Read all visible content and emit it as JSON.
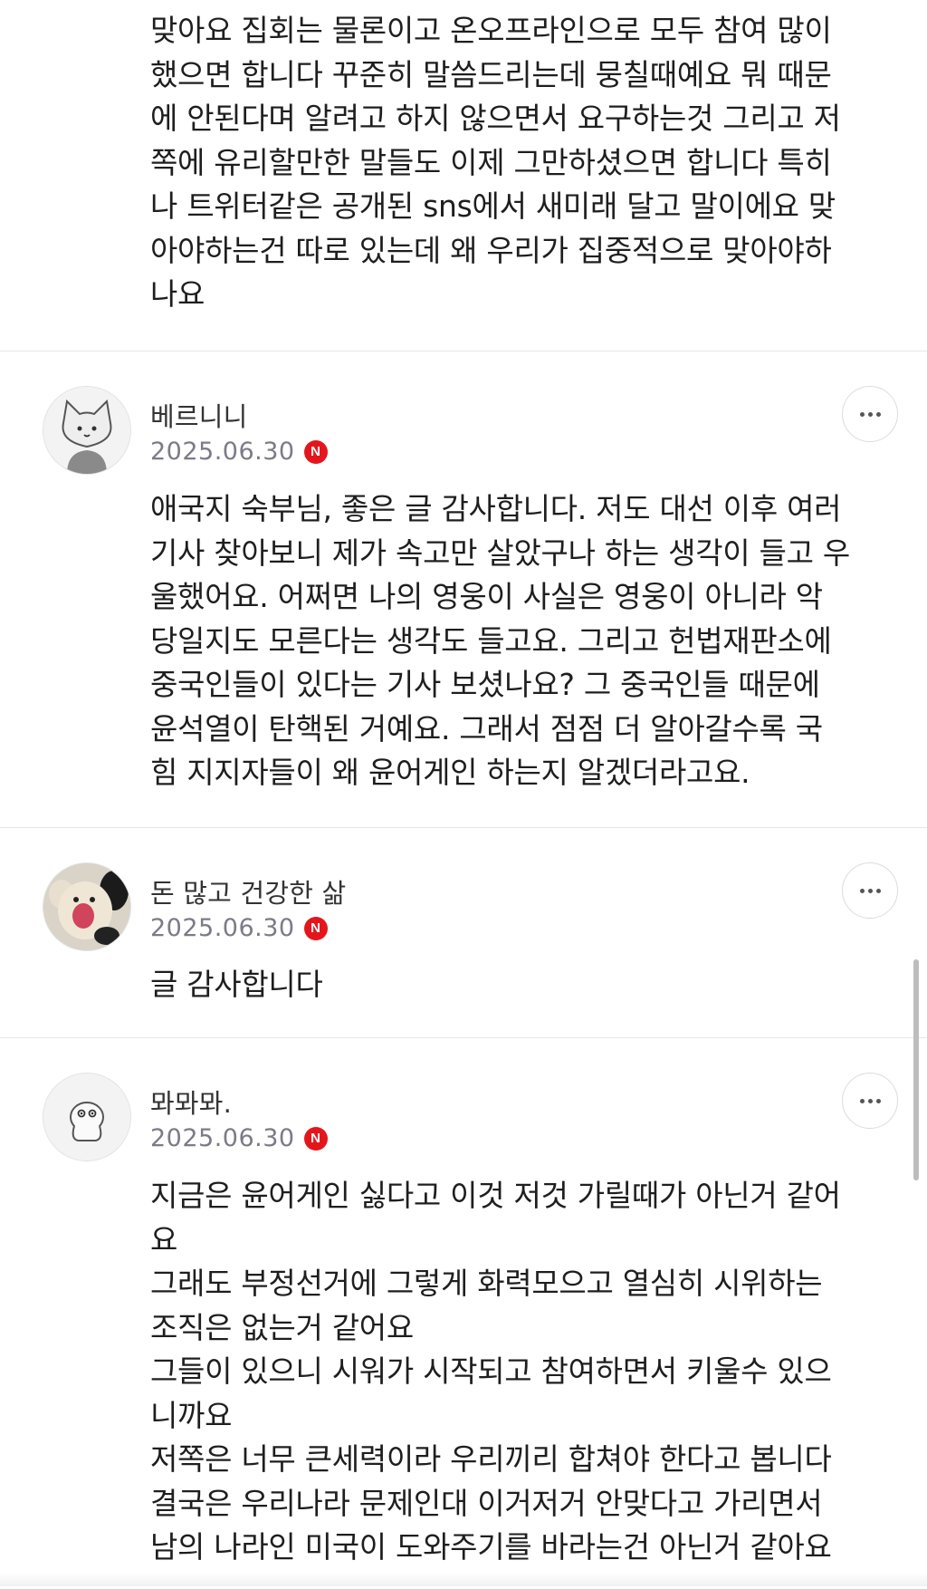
{
  "comments": [
    {
      "continued": true,
      "lines": [
        "맞아요 집회는 물론이고 온오프라인으로 모두 참여 많이",
        "했으면 합니다 꾸준히 말씀드리는데 뭉칠때예요 뭐 때문",
        "에 안된다며 알려고 하지 않으면서 요구하는것 그리고 저",
        "쪽에 유리할만한 말들도 이제 그만하셨으면 합니다 특히",
        "나 트위터같은 공개된 sns에서 새미래 달고 말이에요 맞",
        "아야하는건 따로 있는데 왜 우리가 집중적으로 맞아야하",
        "나요"
      ]
    },
    {
      "author": "베르니니",
      "date": "2025.06.30",
      "badge": "N",
      "avatar": "cat-avatar-icon",
      "lines": [
        "애국지 숙부님, 좋은 글 감사합니다. 저도 대선 이후 여러",
        "기사 찾아보니 제가 속고만 살았구나 하는 생각이 들고 우",
        "울했어요. 어쩌면 나의 영웅이 사실은 영웅이 아니라 악",
        "당일지도 모른다는 생각도 들고요. 그리고 헌법재판소에",
        "중국인들이 있다는 기사 보셨나요? 그 중국인들 때문에",
        "윤석열이 탄핵된 거예요. 그래서 점점 더 알아갈수록 국",
        "힘 지지자들이 왜 윤어게인 하는지 알겠더라고요."
      ]
    },
    {
      "author": "돈 많고 건강한 삶",
      "date": "2025.06.30",
      "badge": "N",
      "avatar": "plush-toy-avatar-icon",
      "lines": [
        "글 감사합니다"
      ]
    },
    {
      "author": "뫄뫄뫄.",
      "date": "2025.06.30",
      "badge": "N",
      "avatar": "character-avatar-icon",
      "lines": [
        "지금은 윤어게인 싫다고 이것 저것 가릴때가 아닌거 같어",
        "요",
        "그래도 부정선거에 그렇게 화력모으고 열심히 시위하는",
        "조직은 없는거 같어요",
        "그들이 있으니 시워가 시작되고 참여하면서 키울수 있으",
        "니까요",
        "저쪽은 너무 큰세력이라 우리끼리 합쳐야 한다고 봅니다",
        "결국은 우리나라 문제인대 이거저거 안맞다고 가리면서",
        "남의 나라인 미국이 도와주기를 바라는건 아닌거 같아요"
      ]
    }
  ],
  "colors": {
    "badge": "#e4161c",
    "date": "#7b7b88",
    "divider": "#e6e6e6",
    "text": "#1e1e1e"
  }
}
